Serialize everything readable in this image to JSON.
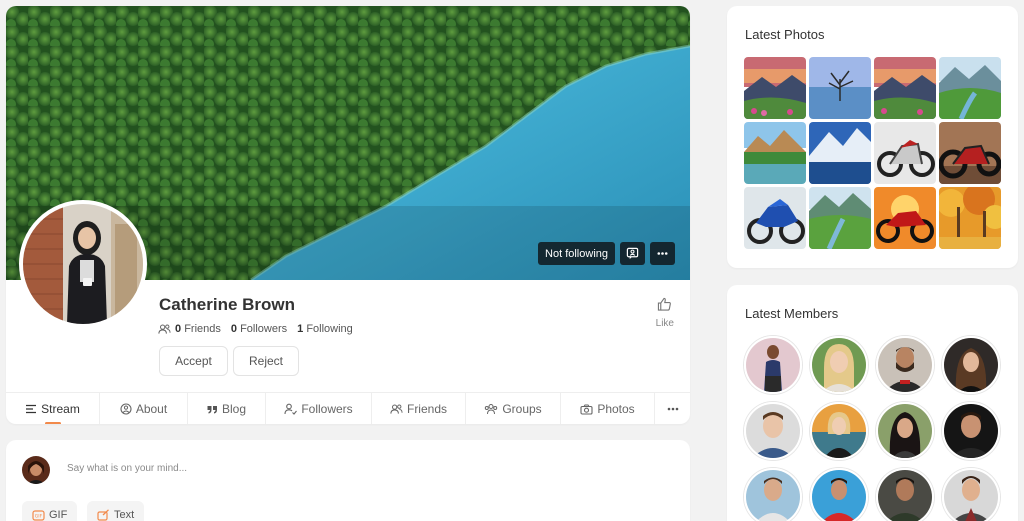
{
  "profile": {
    "name": "Catherine Brown",
    "follow_status": "Not following",
    "stats": [
      {
        "count": "0",
        "label": "Friends"
      },
      {
        "count": "0",
        "label": "Followers"
      },
      {
        "count": "1",
        "label": "Following"
      }
    ],
    "like_label": "Like",
    "accept_label": "Accept",
    "reject_label": "Reject"
  },
  "tabs": [
    {
      "label": "Stream",
      "icon": "stream-icon",
      "active": true
    },
    {
      "label": "About",
      "icon": "user-circle-icon"
    },
    {
      "label": "Blog",
      "icon": "quote-icon"
    },
    {
      "label": "Followers",
      "icon": "user-follow-icon"
    },
    {
      "label": "Friends",
      "icon": "users-icon"
    },
    {
      "label": "Groups",
      "icon": "group-icon"
    },
    {
      "label": "Photos",
      "icon": "camera-icon"
    }
  ],
  "composer": {
    "placeholder": "Say what is on your mind...",
    "gif_label": "GIF",
    "text_label": "Text"
  },
  "latest_photos": {
    "title": "Latest Photos",
    "photos": [
      "sunset-valley",
      "lone-tree-lake",
      "sunset-valley",
      "green-river-valley",
      "mountain-lake",
      "blue-mountain-lake",
      "white-motorcycle",
      "red-chopper",
      "blue-sportbike",
      "valley-river",
      "red-sportbike-sunset",
      "autumn-forest"
    ]
  },
  "latest_members": {
    "title": "Latest Members"
  },
  "colors": {
    "accent": "#f28a4b",
    "lake": "#3aa8cf",
    "forest": "#2e6a2c"
  }
}
